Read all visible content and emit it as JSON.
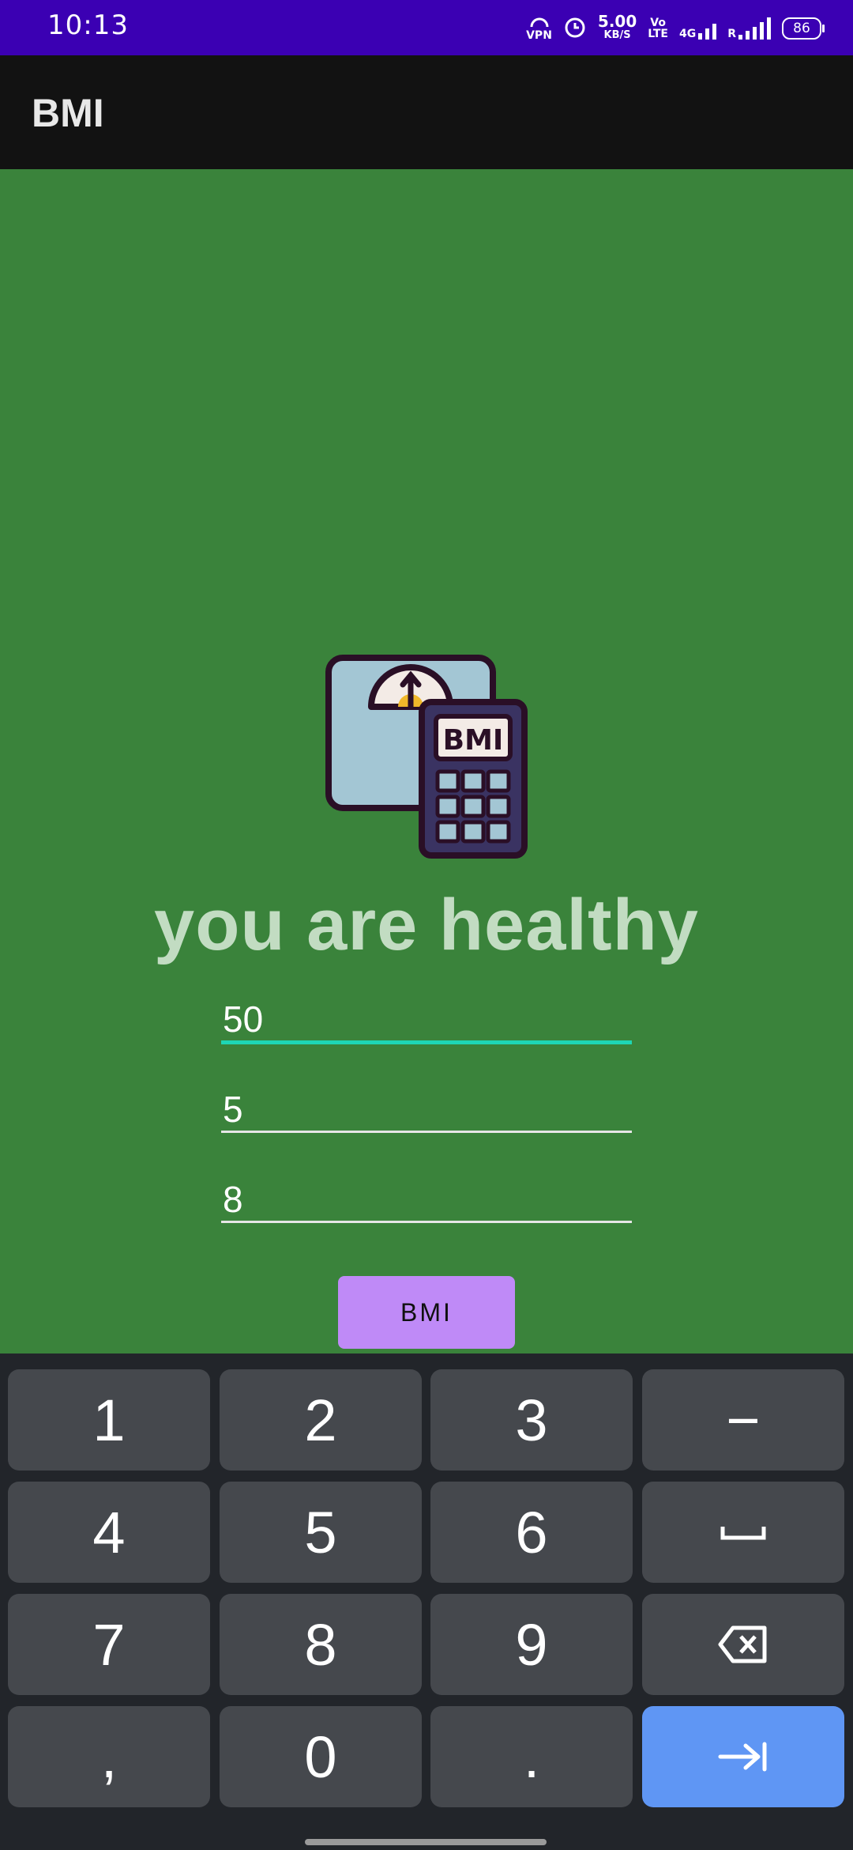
{
  "status_bar": {
    "time": "10:13",
    "vpn": "VPN",
    "speed_value": "5.00",
    "speed_unit": "KB/S",
    "volte_top": "Vo",
    "volte_bottom": "LTE",
    "network": "4G",
    "roaming": "R",
    "battery": "86"
  },
  "app_bar": {
    "title": "BMI"
  },
  "main": {
    "illustration_label": "BMI",
    "result_text": "you are healthy",
    "fields": [
      {
        "value": "50"
      },
      {
        "value": "5"
      },
      {
        "value": "8"
      }
    ],
    "button_label": "BMI"
  },
  "keyboard": {
    "keys": [
      "1",
      "2",
      "3",
      "−",
      "4",
      "5",
      "6",
      "space",
      "7",
      "8",
      "9",
      "backspace",
      ",",
      "0",
      ".",
      "enter"
    ],
    "icons": {
      "space": "space-bar-icon",
      "backspace": "backspace-icon",
      "enter": "tab-enter-icon"
    }
  },
  "colors": {
    "status_bar": "#3b00b3",
    "app_bar": "#121212",
    "background": "#3a833b",
    "accent_underline": "#1ed6b5",
    "button": "#bf8af7",
    "enter_key": "#5f96f4"
  }
}
